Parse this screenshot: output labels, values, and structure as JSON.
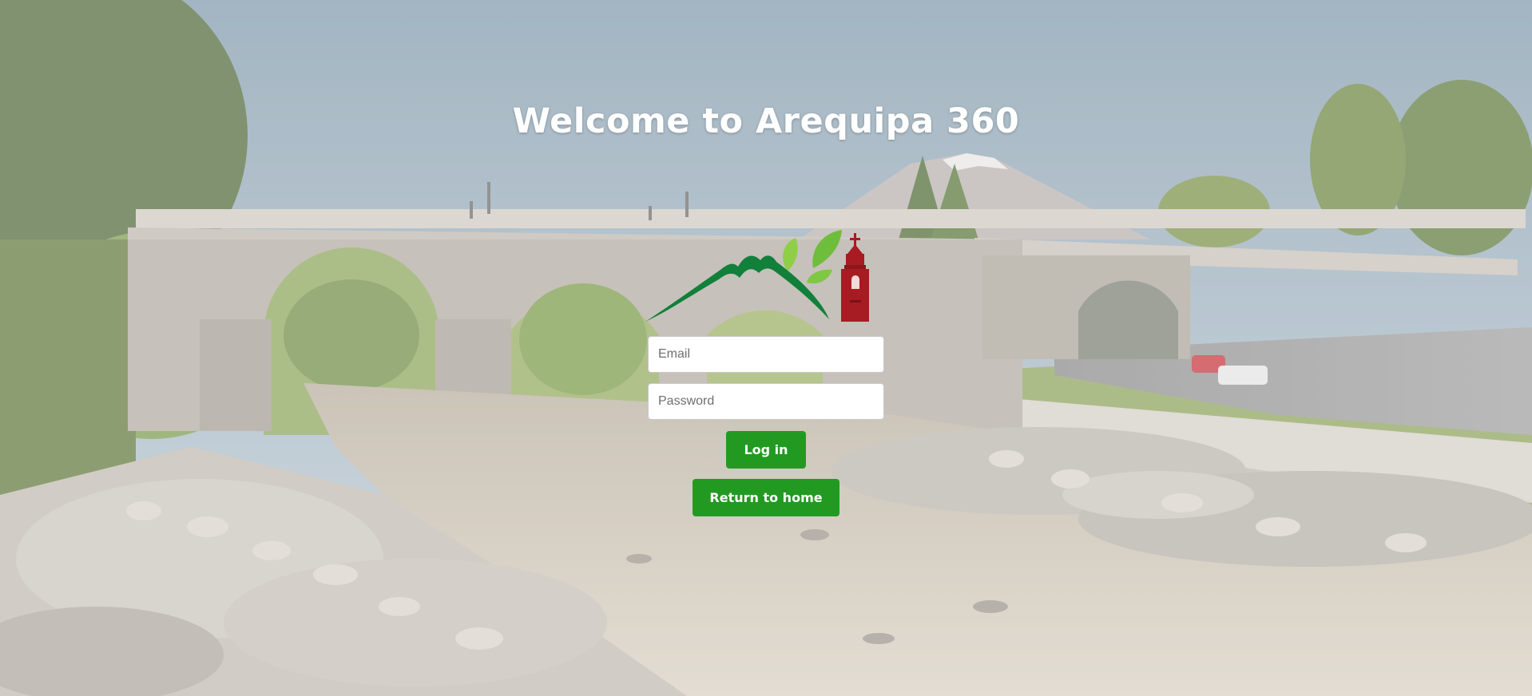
{
  "page": {
    "title": "Welcome to Arequipa 360"
  },
  "login_form": {
    "email_placeholder": "Email",
    "password_placeholder": "Password",
    "login_label": "Log in",
    "return_label": "Return to home"
  },
  "colors": {
    "button": "#229a22",
    "logo_mountain": "#10803a",
    "logo_leaves": "#7dc242",
    "logo_church": "#a61c22"
  },
  "background": {
    "scene": "bridge over river with volcano"
  }
}
